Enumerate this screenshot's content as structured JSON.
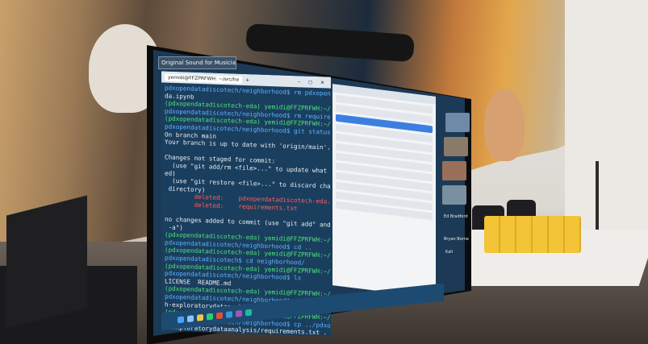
{
  "zoom_bar": {
    "label": "Original Sound for Musicians: Off"
  },
  "terminal": {
    "tab_title": "yemidi@FFZPRFWH: ~/src/he",
    "controls": "– ◻ ✕",
    "lines": [
      {
        "text": "pdxopendatadiscotech/neighborhood$ rm pdxopendatadiscotech-e",
        "color": "b"
      },
      {
        "text": "da.ipynb",
        "color": ""
      },
      {
        "text": "(pdxopendatadiscotech-eda) yemidi@FFZPRFWH:~/src/hackathons/",
        "color": "g"
      },
      {
        "text": "pdxopendatadiscotech/neighborhood$ rm requirements.txt",
        "color": "b"
      },
      {
        "text": "(pdxopendatadiscotech-eda) yemidi@FFZPRFWH:~/src/hackathons/",
        "color": "g"
      },
      {
        "text": "pdxopendatadiscotech/neighborhood$ git status",
        "color": "b"
      },
      {
        "text": "On branch main",
        "color": ""
      },
      {
        "text": "Your branch is up to date with 'origin/main'.",
        "color": ""
      },
      {
        "text": "",
        "color": ""
      },
      {
        "text": "Changes not staged for commit:",
        "color": ""
      },
      {
        "text": "  (use \"git add/rm <file>...\" to update what will be commit",
        "color": ""
      },
      {
        "text": "ed)",
        "color": ""
      },
      {
        "text": "  (use \"git restore <file>...\" to discard changes in working",
        "color": ""
      },
      {
        "text": " directory)",
        "color": ""
      },
      {
        "text": "        deleted:    pdxopendatadiscotech-eda.ipynb",
        "color": "r"
      },
      {
        "text": "        deleted:    requirements.txt",
        "color": "r"
      },
      {
        "text": "",
        "color": ""
      },
      {
        "text": "no changes added to commit (use \"git add\" and/or \"git commit",
        "color": ""
      },
      {
        "text": " -a\")",
        "color": ""
      },
      {
        "text": "(pdxopendatadiscotech-eda) yemidi@FFZPRFWH:~/src/hackathons/",
        "color": "g"
      },
      {
        "text": "pdxopendatadiscotech/neighborhood$ cd ..",
        "color": "b"
      },
      {
        "text": "(pdxopendatadiscotech-eda) yemidi@FFZPRFWH:~/src/hackathons/",
        "color": "g"
      },
      {
        "text": "pdxopendatadiscotech$ cd neighborhood/",
        "color": "b"
      },
      {
        "text": "(pdxopendatadiscotech-eda) yemidi@FFZPRFWH:~/src/hackathons/",
        "color": "g"
      },
      {
        "text": "pdxopendatadiscotech/neighborhood$ ls",
        "color": "b"
      },
      {
        "text": "LICENSE  README.md",
        "color": ""
      },
      {
        "text": "(pdxopendatadiscotech-eda) yemidi@FFZPRFWH:~/src/hackathons/",
        "color": "g"
      },
      {
        "text": "pdxopendatadiscotech/neighborhood$ cp ../pdxopendatadiscotec",
        "color": "b"
      },
      {
        "text": "h-exploratorydataanalysis/pdxopendatadiscotech-eda.ipynb",
        "color": ""
      },
      {
        "text": "(pdxopendatadiscotech-eda) yemidi@FFZPRFWH:~/src/hackathons/",
        "color": "g"
      },
      {
        "text": "pdxopendatadiscotech/neighborhood$ cp ../pdxopendatadiscotec",
        "color": "b"
      },
      {
        "text": "h-exploratorydataanalysis/requirements.txt .",
        "color": ""
      }
    ]
  },
  "participants": {
    "name_1": "Ed Bradford",
    "name_2": "Bryan Borne",
    "name_3": "Kali"
  }
}
